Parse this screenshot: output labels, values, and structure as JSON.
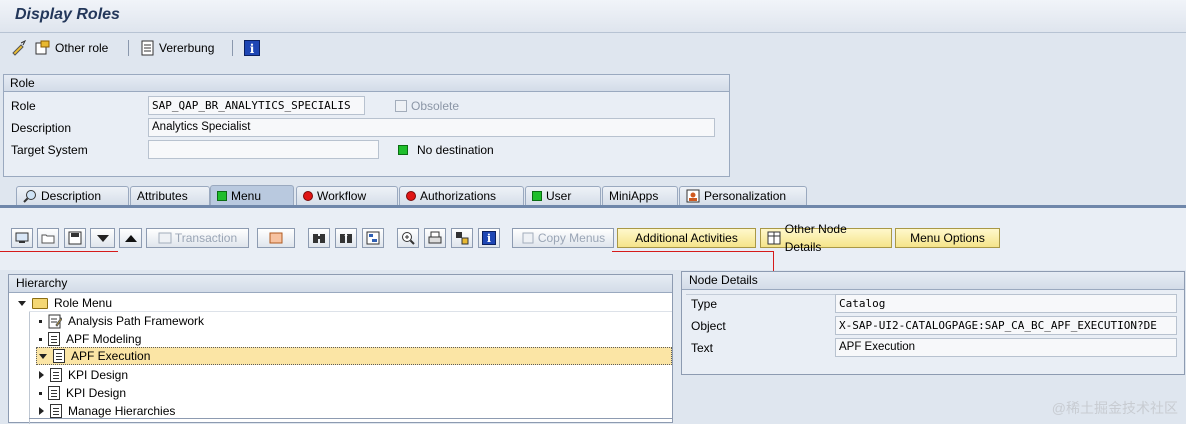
{
  "window": {
    "title": "Display Roles"
  },
  "app_toolbar": {
    "other_role": "Other role",
    "vererbung": "Vererbung"
  },
  "role_group": {
    "header": "Role",
    "role_label": "Role",
    "role_value": "SAP_QAP_BR_ANALYTICS_SPECIALIS",
    "obsolete_label": "Obsolete",
    "description_label": "Description",
    "description_value": "Analytics Specialist",
    "target_label": "Target System",
    "target_value": "",
    "destination_status": "No destination"
  },
  "tabs": [
    "Description",
    "Attributes",
    "Menu",
    "Workflow",
    "Authorizations",
    "User",
    "MiniApps",
    "Personalization"
  ],
  "active_tab": "Menu",
  "menu_toolbar": {
    "transaction": "Transaction",
    "copy_menus": "Copy Menus",
    "additional_activities": "Additional Activities",
    "other_node_details": "Other Node Details",
    "menu_options": "Menu Options"
  },
  "hierarchy": {
    "header": "Hierarchy",
    "root": "Role Menu",
    "items": [
      "Analysis Path Framework",
      "APF Modeling",
      "APF Execution",
      "KPI Design",
      "KPI Design",
      "Manage Hierarchies"
    ],
    "selected": "APF Execution"
  },
  "node_details": {
    "header": "Node Details",
    "type_label": "Type",
    "type_value": "Catalog",
    "object_label": "Object",
    "object_value": "X-SAP-UI2-CATALOGPAGE:SAP_CA_BC_APF_EXECUTION?DE",
    "text_label": "Text",
    "text_value": "APF Execution"
  },
  "watermark": "@稀土掘金技术社区",
  "colors": {
    "accent_highlight": "#fbe5a5",
    "yellow_button": "#f5e48a",
    "status_green": "#1fbe2c",
    "status_red": "#e01515"
  }
}
